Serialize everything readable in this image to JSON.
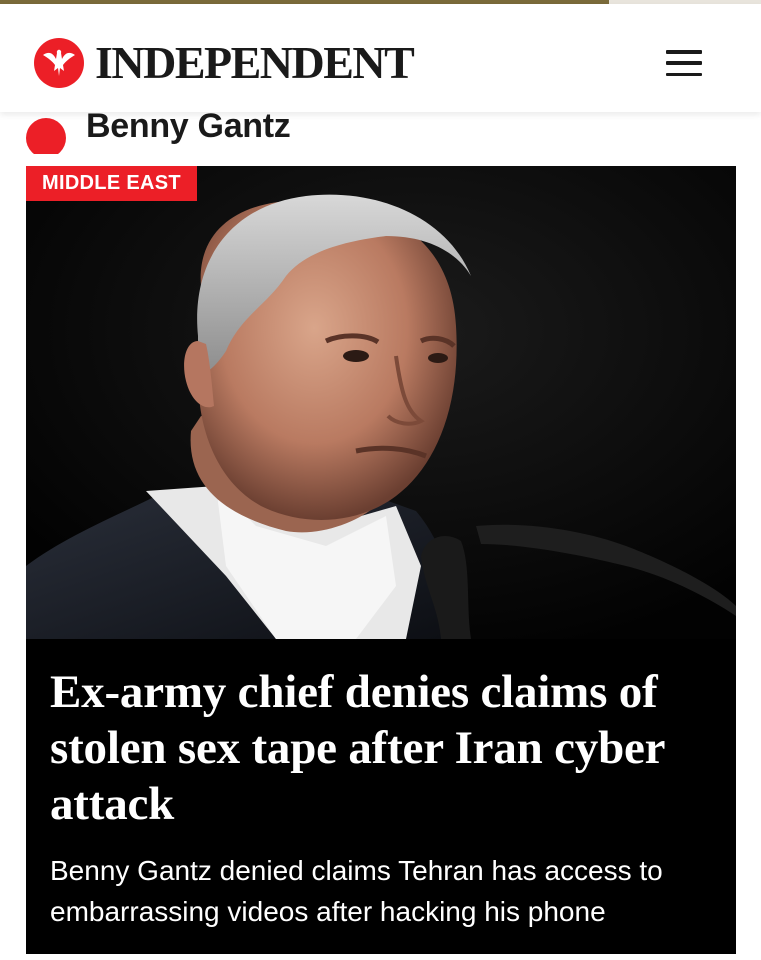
{
  "reading_progress": 0.8,
  "colors": {
    "brand_red": "#ec1f27",
    "progress_gold": "#7a6a3a",
    "header_background": "#ffffff",
    "card_background": "#000000"
  },
  "header": {
    "logo_icon": "eagle-icon",
    "logo_text": "INDEPENDENT",
    "menu_icon": "hamburger-menu-icon"
  },
  "topic": {
    "indicator_icon": "red-dot-icon",
    "title": "Benny Gantz"
  },
  "article": {
    "section_tag": "MIDDLE EAST",
    "image_subject": "man-at-microphone-photo",
    "headline": "Ex-army chief denies claims of stolen sex tape after Iran cyber attack",
    "standfirst": "Benny Gantz denied claims Tehran has access to embarrassing videos after hacking his phone"
  }
}
